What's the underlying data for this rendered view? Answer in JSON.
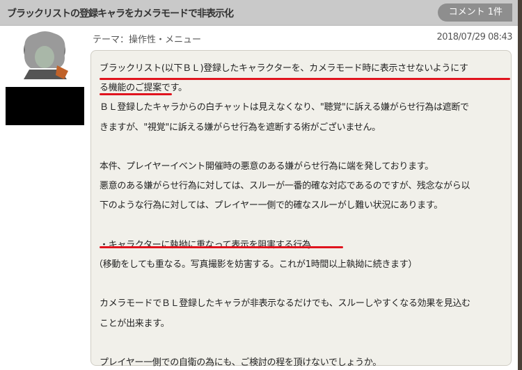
{
  "header": {
    "title": "ブラックリストの登録キャラをカメラモードで非表示化",
    "comment_button": "コメント 1件"
  },
  "post": {
    "theme": "テーマ：操作性・メニュー",
    "date": "2018/07/29 08:43",
    "lines": [
      "ブラックリスト(以下ＢＬ)登録したキャラクターを、カメラモード時に表示させないようにす",
      "る機能のご提案です。",
      "ＢＬ登録したキャラからの白チャットは見えなくなり、\"聴覚\"に訴える嫌がらせ行為は遮断で",
      "きますが、\"視覚\"に訴える嫌がらせ行為を遮断する術がございません。",
      "",
      "本件、プレイヤーイベント開催時の悪意のある嫌がらせ行為に端を発しております。",
      "悪意のある嫌がらせ行為に対しては、スルーが一番的確な対応であるのですが、残念ながら以",
      "下のような行為に対しては、プレイヤー一側で的確なスルーがし難い状況にあります。",
      "",
      "・キャラクターに執拗に重なって表示を阻害する行為",
      "（移動をしても重なる。写真撮影を妨害する。これが1時間以上執拗に続きます）",
      "",
      "カメラモードでＢＬ登録したキャラが非表示なるだけでも、スルーしやすくなる効果を見込む",
      "ことが出来ます。",
      "",
      "プレイヤー一側での自衛の為にも、ご検討の程を頂けないでしょうか。"
    ]
  },
  "colors": {
    "underline": "#e0141e",
    "header": "#c9c9c9"
  }
}
